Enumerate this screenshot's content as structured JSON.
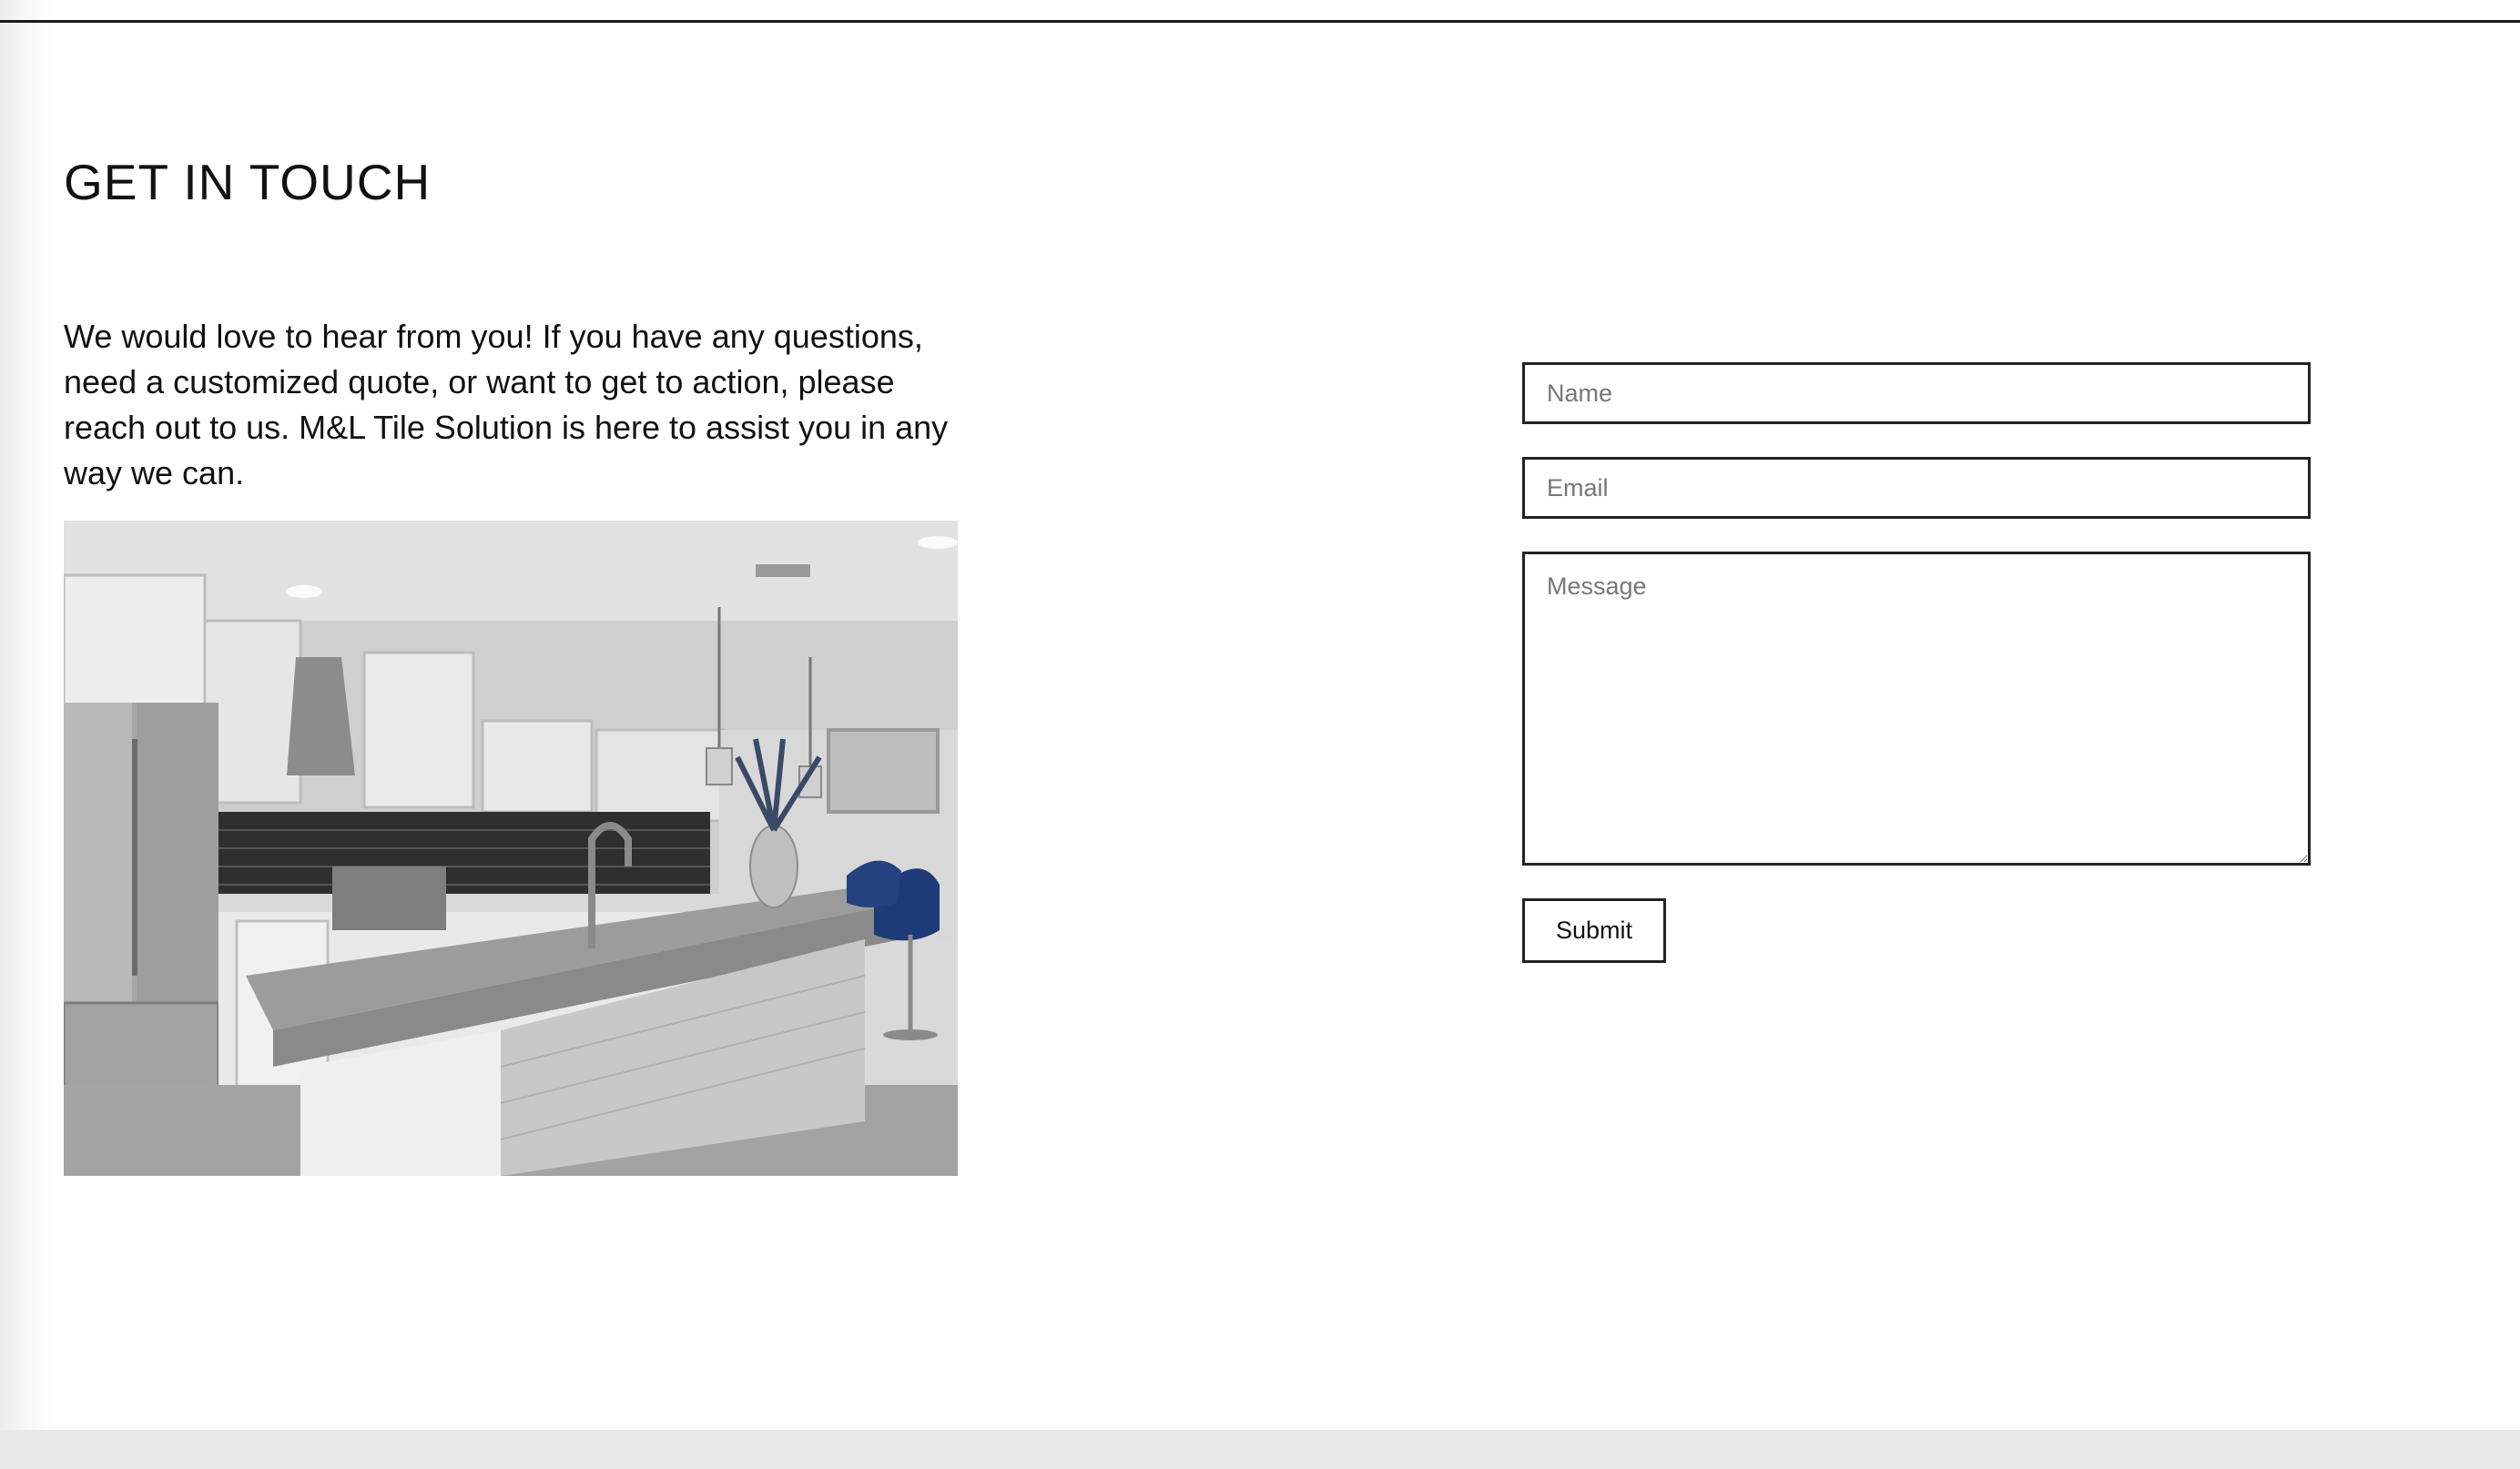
{
  "contact": {
    "title": "GET IN TOUCH",
    "intro": "We would love to hear from you! If you have any questions, need a customized quote, or want to get to action, please reach out to us. M&L Tile Solution is here to assist you in any way we can."
  },
  "form": {
    "name_placeholder": "Name",
    "email_placeholder": "Email",
    "message_placeholder": "Message",
    "submit_label": "Submit"
  }
}
